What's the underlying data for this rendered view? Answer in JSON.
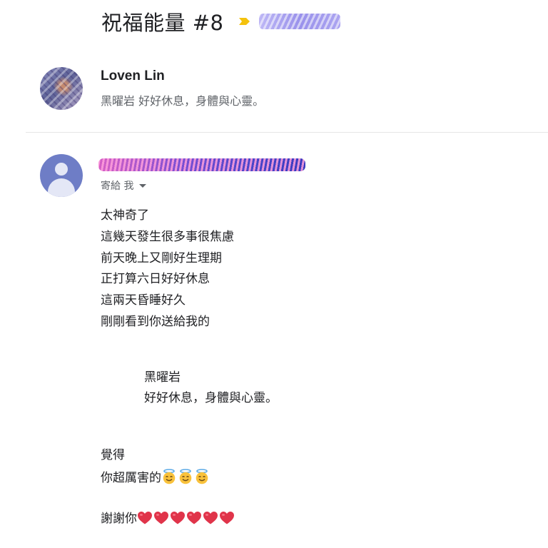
{
  "subject": {
    "title": "祝福能量 #8",
    "label_arrow_color": "#f4c20d",
    "label_icon": "label-arrow-icon"
  },
  "message1": {
    "sender_name": "Loven Lin",
    "snippet": "黑曜岩 好好休息，身體與心靈。"
  },
  "message2": {
    "to_line": "寄給 我",
    "expand_icon": "caret-down-icon",
    "body_lines": [
      "太神奇了",
      "這幾天發生很多事很焦慮",
      "前天晚上又剛好生理期",
      "正打算六日好好休息",
      "這兩天昏睡好久",
      "剛剛看到你送給我的"
    ],
    "quote_lines": [
      "黑曜岩",
      "好好休息，身體與心靈。"
    ],
    "closing_line1": "覺得",
    "closing_line2": "你超厲害的",
    "closing_line2_emoji": "halo-smile-emoji",
    "closing_line2_emoji_count": 3,
    "thanks": "謝謝你",
    "thanks_emoji": "red-heart-emoji",
    "thanks_emoji_count": 6
  },
  "colors": {
    "avatar_default": "#6e7dc6",
    "secondary_text": "#5f6368",
    "heart": "#e0344a",
    "halo_face": "#f9c23c"
  }
}
